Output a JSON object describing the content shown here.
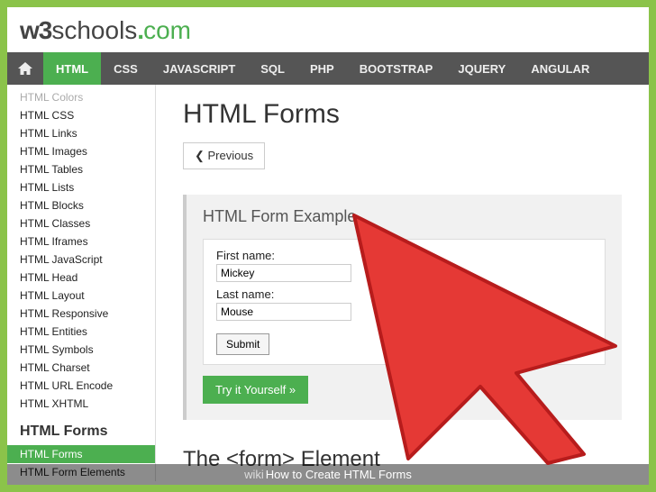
{
  "logo": {
    "part1": "w3",
    "part2": "schools",
    "part3": ".",
    "part4": "com"
  },
  "topnav": [
    {
      "label": "HTML",
      "active": true
    },
    {
      "label": "CSS"
    },
    {
      "label": "JAVASCRIPT"
    },
    {
      "label": "SQL"
    },
    {
      "label": "PHP"
    },
    {
      "label": "BOOTSTRAP"
    },
    {
      "label": "JQUERY"
    },
    {
      "label": "ANGULAR"
    }
  ],
  "sidebar": {
    "items": [
      "HTML Colors",
      "HTML CSS",
      "HTML Links",
      "HTML Images",
      "HTML Tables",
      "HTML Lists",
      "HTML Blocks",
      "HTML Classes",
      "HTML Iframes",
      "HTML JavaScript",
      "HTML Head",
      "HTML Layout",
      "HTML Responsive",
      "HTML Entities",
      "HTML Symbols",
      "HTML Charset",
      "HTML URL Encode",
      "HTML XHTML"
    ],
    "section_heading": "HTML Forms",
    "section_items": [
      {
        "label": "HTML Forms",
        "active": true
      },
      {
        "label": "HTML Form Elements",
        "active": false
      }
    ]
  },
  "main": {
    "title": "HTML Forms",
    "prev_label": "❮ Previous",
    "example_heading": "HTML Form Example",
    "form": {
      "first_label": "First name:",
      "first_value": "Mickey",
      "last_label": "Last name:",
      "last_value": "Mouse",
      "submit_label": "Submit"
    },
    "try_label": "Try it Yourself »",
    "section2": "The <form> Element"
  },
  "caption": {
    "wiki": "wiki",
    "rest": "How to Create HTML Forms"
  }
}
